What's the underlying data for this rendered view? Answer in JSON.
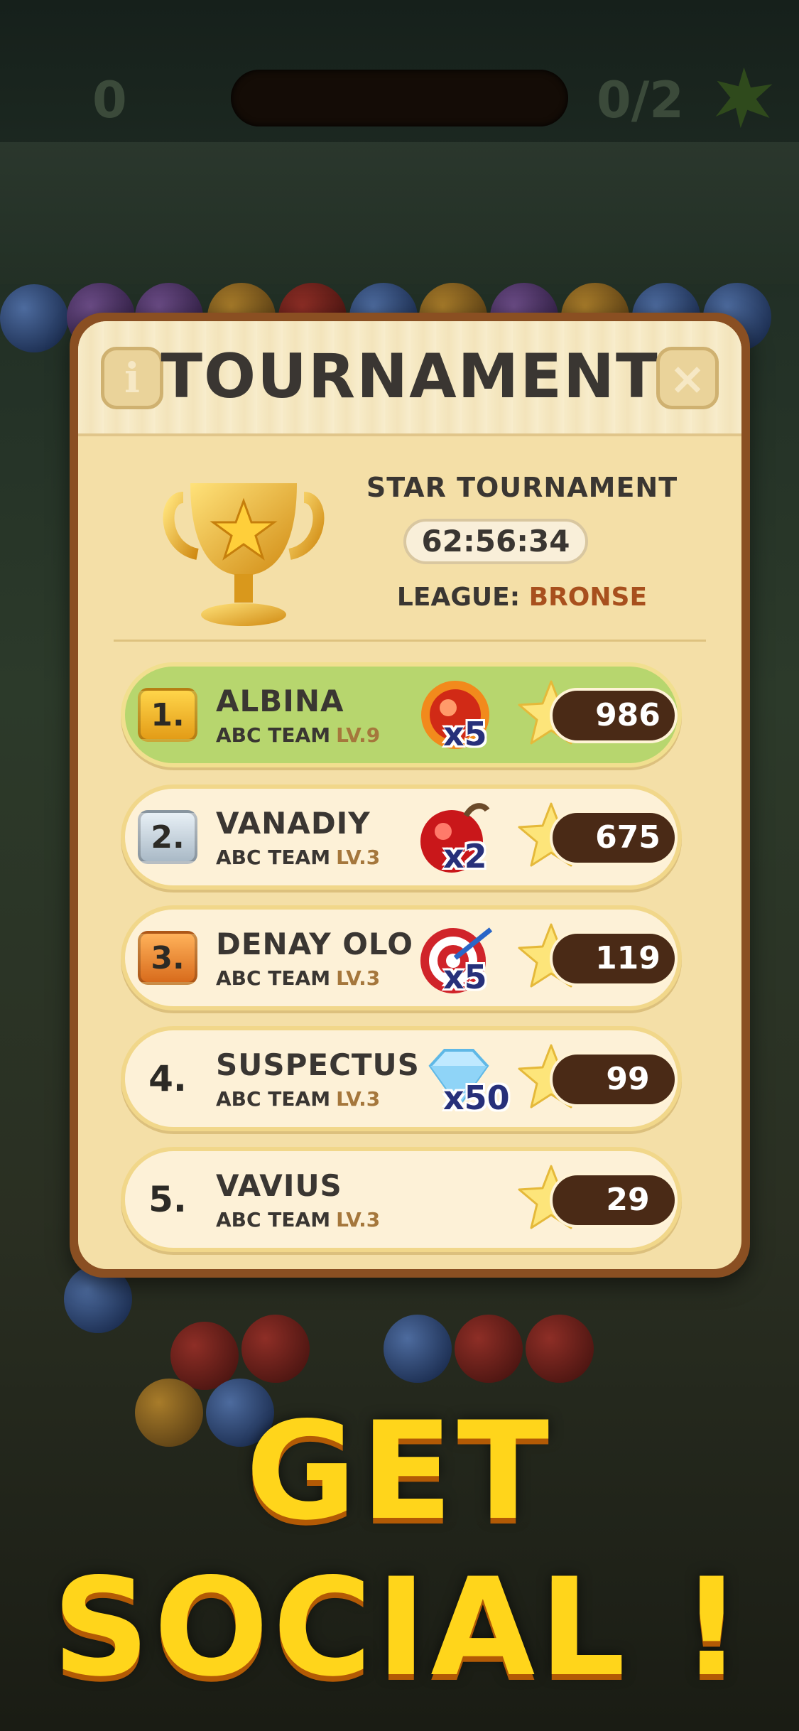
{
  "hud": {
    "score": "0",
    "moves": "0/2"
  },
  "panel": {
    "title": "TOURNAMENT",
    "info_icon": "i",
    "close_icon": "×",
    "tournament_name": "STAR TOURNAMENT",
    "timer": "62:56:34",
    "league_label": "LEAGUE:",
    "league_value": "BRONSE"
  },
  "players": [
    {
      "rank": "1.",
      "name": "ALBINA",
      "team": "ABC TEAM",
      "level": "LV.9",
      "prize_icon": "fire-ball-icon",
      "prize_count": "x5",
      "score": "986"
    },
    {
      "rank": "2.",
      "name": "VANADIY",
      "team": "ABC TEAM",
      "level": "LV.3",
      "prize_icon": "bomb-icon",
      "prize_count": "x2",
      "score": "675"
    },
    {
      "rank": "3.",
      "name": "DENAY OLO",
      "team": "ABC TEAM",
      "level": "LV.3",
      "prize_icon": "target-icon",
      "prize_count": "x5",
      "score": "119"
    },
    {
      "rank": "4.",
      "name": "SUSPECTUS",
      "team": "ABC TEAM",
      "level": "LV.3",
      "prize_icon": "diamond-icon",
      "prize_count": "x50",
      "score": "99"
    },
    {
      "rank": "5.",
      "name": "VAVIUS",
      "team": "ABC TEAM",
      "level": "LV.3",
      "prize_icon": "",
      "prize_count": "",
      "score": "29"
    }
  ],
  "cta": {
    "line1": "GET",
    "line2": "SOCIAL !"
  },
  "colors": {
    "panel_frame": "#8a4f22",
    "panel_bg": "#f4dfa7",
    "first_row": "#b7d66e",
    "cta_yellow": "#ffd51b",
    "league_value": "#a8501d"
  }
}
